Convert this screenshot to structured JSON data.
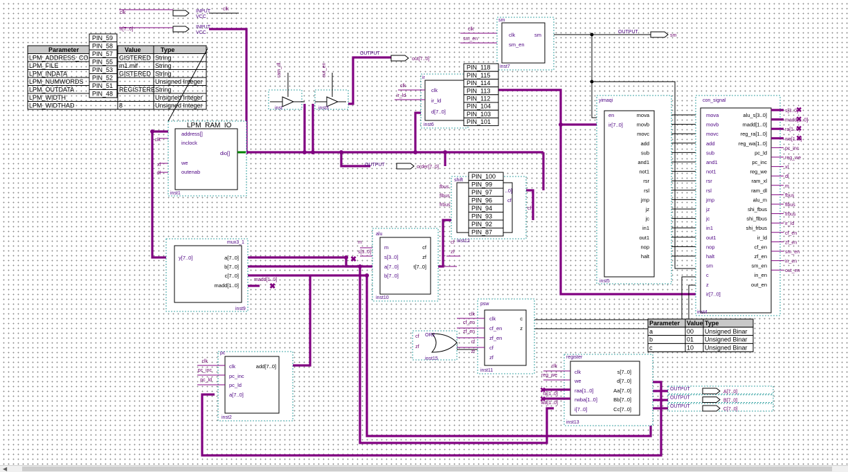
{
  "rom_table": {
    "headers": [
      "Parameter",
      "Value",
      "Type"
    ],
    "rows": [
      [
        "LPM_ADDRESS_CO",
        "GISTERED",
        "String"
      ],
      [
        "LPM_FILE",
        "m1.mif",
        "String"
      ],
      [
        "LPM_INDATA",
        "GISTERED",
        "String"
      ],
      [
        "LPM_NUMWORDS",
        "",
        "Unsigned Integer"
      ],
      [
        "LPM_OUTDATA",
        "REGISTERE",
        "String"
      ],
      [
        "LPM_WIDTH",
        "",
        "Unsigned Integer"
      ],
      [
        "LPM_WIDTHAD",
        "8",
        "Unsigned Integer"
      ]
    ]
  },
  "pins_a": [
    "PIN_59",
    "PIN_58",
    "PIN_57",
    "PIN_55",
    "PIN_53",
    "PIN_52",
    "PIN_51",
    "PIN_48"
  ],
  "pins_b": [
    "PIN_118",
    "PIN_115",
    "PIN_114",
    "PIN_113",
    "PIN_112",
    "PIN_104",
    "PIN_103",
    "PIN_101"
  ],
  "pins_c": [
    "PIN_100",
    "PIN_99",
    "PIN_97",
    "PIN_96",
    "PIN_94",
    "PIN_93",
    "PIN_92",
    "PIN_87"
  ],
  "top": {
    "clk_in": "clk",
    "vcc_a": "INPUT",
    "vcc_a2": "VCC",
    "clk_out": "clk",
    "ir_in": "ir[7..0]",
    "vcc_b": "INPUT",
    "vcc_b2": "VCC",
    "out_port": "OUTPUT",
    "out_name": "out[7..0]",
    "order_port": "OUTPUT",
    "order_name": "order[7..0]",
    "sm_port": "OUTPUT",
    "sm_name": "sm",
    "tri1_sig": "ram_dl",
    "tri1_inst": "inst",
    "tri2_sig": "out_en",
    "tri2_inst": "inst3"
  },
  "ram": {
    "title": "LPM_RAM_IO",
    "ports": [
      "address[]",
      "inclock",
      "we",
      "outenab"
    ],
    "out": "dio[]",
    "inst": "inst1",
    "sig_clk": "clk",
    "sig_we": "xl",
    "sig_dl": "dl"
  },
  "sm": {
    "title": "sm",
    "in1": "clk",
    "in2": "sm_en",
    "out": "sm",
    "inst": "inst7",
    "sig_clk": "clk",
    "sig_smen": "sm_en"
  },
  "ir": {
    "title": "ir",
    "in1": "clk",
    "in2": "ir_ld",
    "in3": "d[7..0]",
    "inst": "inst6",
    "sig_clk": "clk",
    "sig_irld": "ir_ld"
  },
  "shift": {
    "title": "shift",
    "in1": "fbus",
    "in2": "flbus",
    "in3": "frbus",
    "out1": "..0]",
    "out2": "cf",
    "inst": "inst12",
    "sig_cf": "cf"
  },
  "yimaqi": {
    "title": "yimaqi",
    "left": [
      "en",
      "ir[7..0]"
    ],
    "right": [
      "mova",
      "movb",
      "movc",
      "add",
      "sub",
      "and1",
      "not1",
      "rsr",
      "rsl",
      "jmp",
      "jz",
      "jc",
      "in1",
      "out1",
      "nop",
      "halt"
    ],
    "inst": "inst5"
  },
  "con": {
    "title": "con_signal",
    "left": [
      "mova",
      "movb",
      "movc",
      "add",
      "sub",
      "and1",
      "not1",
      "rsr",
      "rsl",
      "jmp",
      "jz",
      "jc",
      "in1",
      "out1",
      "nop",
      "halt",
      "sm",
      "c",
      "z",
      "ir[7..0]"
    ],
    "right": [
      "alu_s[3..0]",
      "madd[1..0]",
      "reg_ra[1..0]",
      "reg_wa[1..0]",
      "pc_ld",
      "pc_inc",
      "reg_we",
      "ram_xl",
      "ram_dl",
      "alu_m",
      "shi_fbus",
      "shi_flbus",
      "shi_frbus",
      "ir_ld",
      "cf_en",
      "zf_en",
      "sm_en",
      "in_en",
      "out_en"
    ],
    "outsigs": [
      "s[3..0]",
      "madd[1..0]",
      "ra[1..0]",
      "wa[1..0]",
      "pc_inc",
      "reg_we",
      "xl",
      "dl",
      "m",
      "fbus",
      "flbus",
      "frbus",
      "ir_ld",
      "cf_en",
      "zf_en",
      "sm_en",
      "in_en",
      "out_en"
    ],
    "inst": "inst4"
  },
  "mux": {
    "title": "mux3_1",
    "out": "y[7..0]",
    "in": [
      "a[7..0]",
      "b[7..0]",
      "c[7..0]",
      "madd[1..0]"
    ],
    "inst": "inst9",
    "sig_madd": "madd[1..0]"
  },
  "alu": {
    "title": "alu",
    "in": [
      "m",
      "s[3..0]",
      "a[7..0]",
      "b[7..0]"
    ],
    "out": [
      "cf",
      "zf",
      "t[7..0]"
    ],
    "inst": "inst10",
    "sig_m": "m",
    "sig_s": "s[3..0]",
    "sig_cf": "cf",
    "sig_zf": "zf"
  },
  "psw": {
    "title": "psw",
    "in": [
      "clk",
      "cf_en",
      "zf_en",
      "cf",
      "zf"
    ],
    "out": [
      "c",
      "z"
    ],
    "inst": "inst11",
    "sigs": [
      "clk",
      "cf_en",
      "zf_en",
      "cf",
      "zf"
    ]
  },
  "or2": {
    "title": "OR2",
    "inst": "inst15",
    "in1": "cf",
    "in2": "zf"
  },
  "pc": {
    "title": "pc",
    "in": [
      "clk",
      "pc_inc",
      "pc_ld",
      "a[7..0]"
    ],
    "out": "add[7..0]",
    "inst": "inst2",
    "sigs": [
      "clk",
      "pc_inc",
      "pc_ld"
    ]
  },
  "reg": {
    "title": "register",
    "in": [
      "clk",
      "we",
      "raa[1..0]",
      "rwba[1..0]",
      "i[7..0]"
    ],
    "out": [
      "s[7..0]",
      "d[7..0]",
      "Aa[7..0]",
      "Bb[7..0]",
      "Cc[7..0]"
    ],
    "inst": "inst13",
    "sigs": [
      "clk",
      "reg_we",
      "ra[1..0]",
      "wa[1..0]"
    ],
    "outports": [
      [
        "OUTPUT",
        "A[7..0]"
      ],
      [
        "OUTPUT",
        "B[7..0]"
      ],
      [
        "OUTPUT",
        "C[7..0]"
      ]
    ]
  },
  "param_table": {
    "headers": [
      "Parameter",
      "Value",
      "Type"
    ],
    "rows": [
      [
        "a",
        "00",
        "Unsigned Binar"
      ],
      [
        "b",
        "01",
        "Unsigned Binar"
      ],
      [
        "c",
        "10",
        "Unsigned Binar"
      ]
    ]
  },
  "colors": {
    "wire": "#000000",
    "bus": "#800080",
    "dot": "#8c8c8c",
    "instance_border": "#008b8b"
  }
}
